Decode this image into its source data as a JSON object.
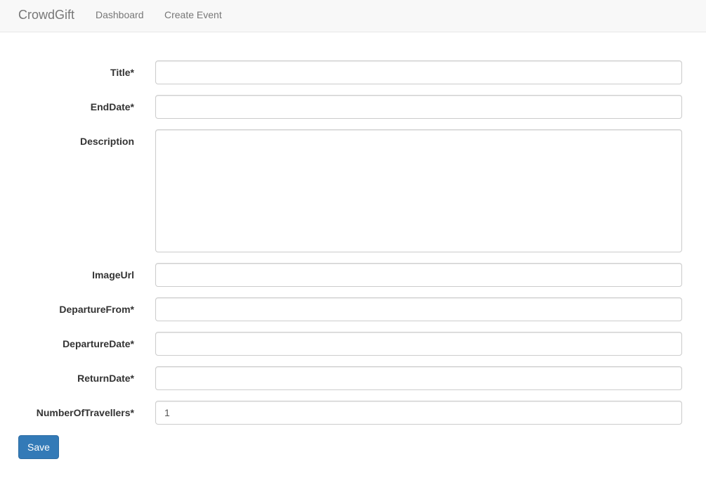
{
  "navbar": {
    "brand": "CrowdGift",
    "links": [
      "Dashboard",
      "Create Event"
    ]
  },
  "form": {
    "fields": [
      {
        "label": "Title*",
        "value": "",
        "type": "text"
      },
      {
        "label": "EndDate*",
        "value": "",
        "type": "text"
      },
      {
        "label": "Description",
        "value": "",
        "type": "textarea"
      },
      {
        "label": "ImageUrl",
        "value": "",
        "type": "text"
      },
      {
        "label": "DepartureFrom*",
        "value": "",
        "type": "text"
      },
      {
        "label": "DepartureDate*",
        "value": "",
        "type": "text"
      },
      {
        "label": "ReturnDate*",
        "value": "",
        "type": "text"
      },
      {
        "label": "NumberOfTravellers*",
        "value": "1",
        "type": "text"
      }
    ],
    "save_label": "Save"
  },
  "colors": {
    "navbar_background": "#f8f8f8",
    "nav_text": "#777777",
    "primary_button": "#337ab7"
  }
}
